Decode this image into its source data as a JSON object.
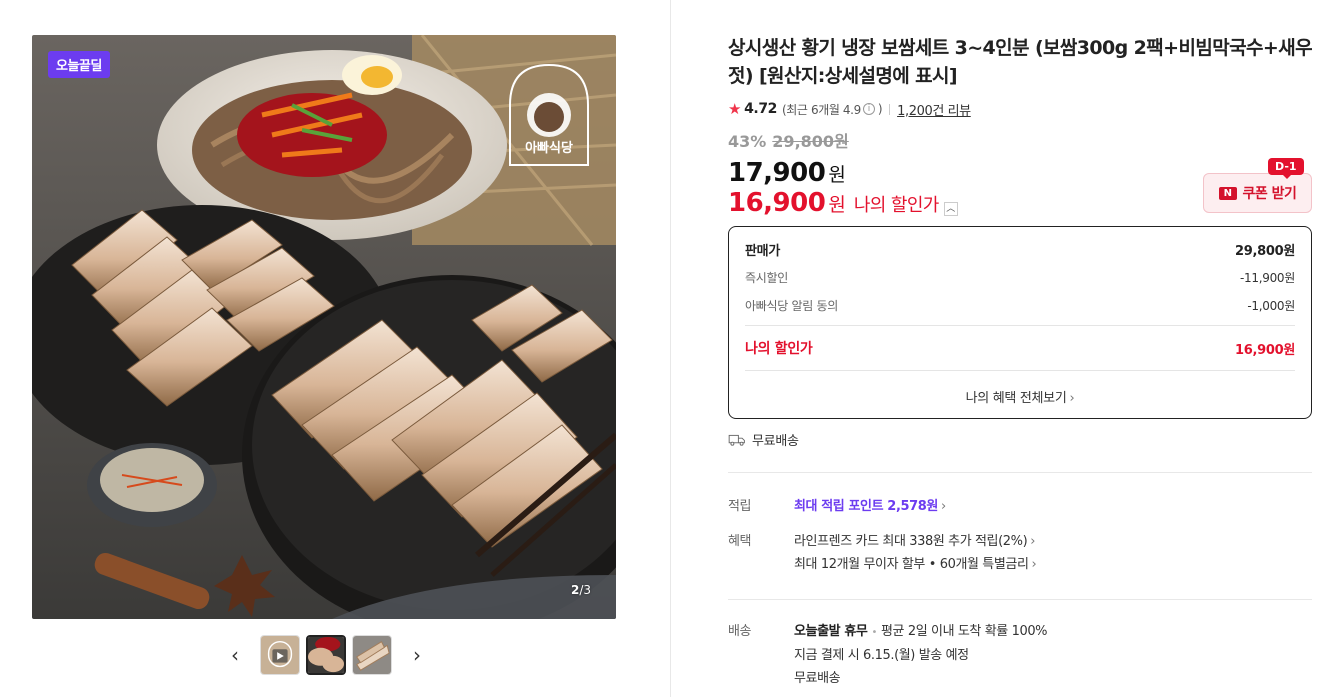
{
  "gallery": {
    "badge": "오늘끝딜",
    "page_current": "2",
    "page_total": "/3",
    "prev_label": "‹",
    "next_label": "›",
    "logo_text": "아빠식당"
  },
  "product": {
    "title": "상시생산 황기 냉장 보쌈세트 3~4인분 (보쌈300g 2팩+비빔막국수+새우젓) [원산지:상세설명에 표시]",
    "rating": "4.72",
    "rating_recent": "(최근 6개월 4.9",
    "rating_recent_end": ")",
    "review_count": "1,200건 리뷰",
    "discount_rate": "43%",
    "original_price": "29,800원",
    "price": "17,900",
    "price_unit": "원",
    "my_price": "16,900",
    "my_price_unit": "원",
    "my_price_label": "나의 할인가",
    "coupon_label": "쿠폰 받기",
    "coupon_dday": "D-1"
  },
  "price_box": {
    "rows": [
      {
        "label": "판매가",
        "value": "29,800원"
      },
      {
        "label": "즉시할인",
        "value": "-11,900원"
      },
      {
        "label": "아빠식당 알림 동의",
        "value": "-1,000원"
      }
    ],
    "total_label": "나의 할인가",
    "total_value": "16,900원",
    "benefit_link": "나의 혜택 전체보기"
  },
  "shipping": {
    "free_label": "무료배송"
  },
  "details": {
    "points_label": "적립",
    "points_text": "최대 적립 포인트 2,578원",
    "benefits_label": "혜택",
    "benefit_1": "라인프렌즈 카드 최대 338원 추가 적립(2%)",
    "benefit_2": "최대 12개월 무이자 할부 • 60개월 특별금리",
    "delivery_label": "배송",
    "delivery_title": "오늘출발 휴무",
    "delivery_stat": "평균 2일 이내 도착 확률 100%",
    "delivery_date": "지금 결제 시 6.15.(월) 발송 예정",
    "delivery_free": "무료배송"
  },
  "colors": {
    "accent_red": "#e3112d",
    "badge_purple": "#6c3cf0"
  }
}
